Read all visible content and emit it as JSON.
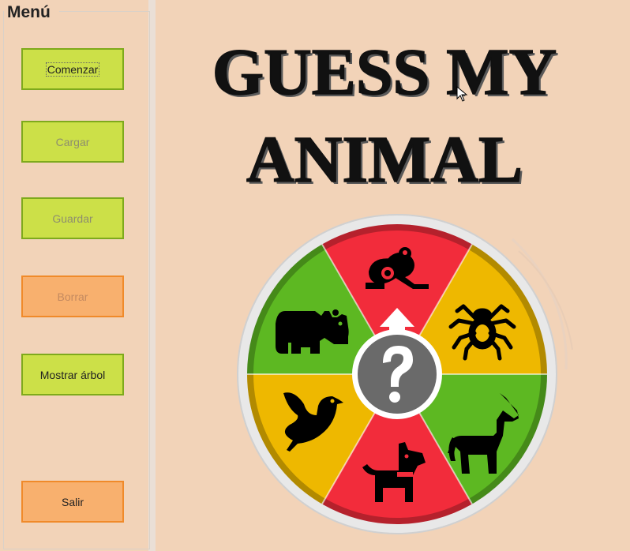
{
  "menu": {
    "title": "Menú",
    "buttons": [
      {
        "label": "Comenzar",
        "enabled": true
      },
      {
        "label": "Cargar",
        "enabled": false
      },
      {
        "label": "Guardar",
        "enabled": false
      },
      {
        "label": "Borrar",
        "enabled": false
      },
      {
        "label": "Mostrar árbol",
        "enabled": true
      },
      {
        "label": "Salir",
        "enabled": true
      }
    ]
  },
  "title": {
    "line1": "GUESS MY",
    "line2": "ANIMAL"
  },
  "wheel": {
    "center_icon": "question-mark-icon",
    "segments": [
      {
        "icon": "frog-icon",
        "color": "#f22c3b"
      },
      {
        "icon": "spider-icon",
        "color": "#eeb800"
      },
      {
        "icon": "horse-icon",
        "color": "#5db822"
      },
      {
        "icon": "dog-icon",
        "color": "#f22c3b"
      },
      {
        "icon": "dove-icon",
        "color": "#eeb800"
      },
      {
        "icon": "hippo-icon",
        "color": "#5db822"
      }
    ]
  },
  "colors": {
    "background": "#f2d3b8",
    "button_green": "#cce048",
    "button_orange": "#f8b06e"
  }
}
